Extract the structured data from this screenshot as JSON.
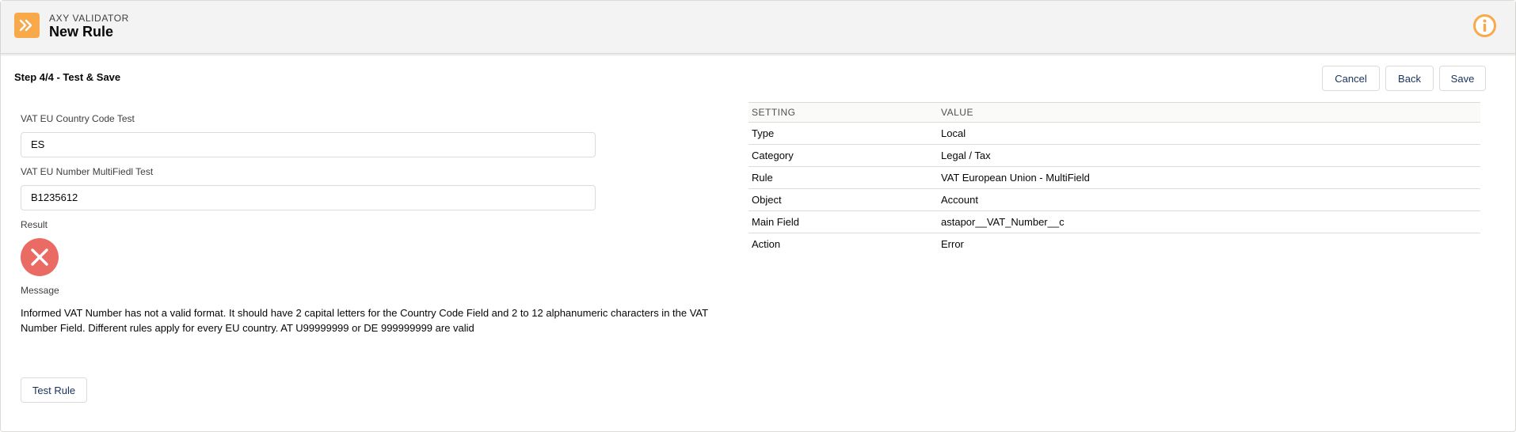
{
  "header": {
    "eyebrow": "AXY VALIDATOR",
    "title": "New Rule",
    "app_icon": "chevrons-right-icon",
    "info_icon": "info-icon",
    "accent_color": "#f8a94a"
  },
  "toolbar": {
    "step_title": "Step 4/4 - Test & Save",
    "cancel_label": "Cancel",
    "back_label": "Back",
    "save_label": "Save"
  },
  "form": {
    "country_code_label": "VAT EU Country Code Test",
    "country_code_value": "ES",
    "vat_number_label": "VAT EU Number MultiFiedl Test",
    "vat_number_value": "B1235612",
    "result_label": "Result",
    "result_icon": "error-x-icon",
    "result_color": "#ea6b64",
    "message_label": "Message",
    "message_text": "Informed VAT Number has not a valid format. It should have 2 capital letters for the Country Code Field and 2 to 12 alphanumeric characters in the VAT Number Field. Different rules apply for every EU country. AT U99999999 or DE 999999999 are valid",
    "test_button_label": "Test Rule"
  },
  "settings_table": {
    "headers": [
      "SETTING",
      "VALUE"
    ],
    "rows": [
      [
        "Type",
        "Local"
      ],
      [
        "Category",
        "Legal / Tax"
      ],
      [
        "Rule",
        "VAT European Union - MultiField"
      ],
      [
        "Object",
        "Account"
      ],
      [
        "Main Field",
        "astapor__VAT_Number__c"
      ],
      [
        "Action",
        "Error"
      ]
    ]
  }
}
